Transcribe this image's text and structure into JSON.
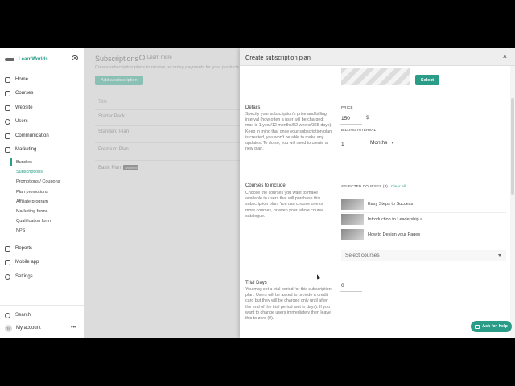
{
  "sidebar": {
    "brand": "LearnWorlds",
    "items": {
      "home": "Home",
      "courses": "Courses",
      "website": "Website",
      "users": "Users",
      "communication": "Communication",
      "marketing": "Marketing",
      "reports": "Reports",
      "mobile_app": "Mobile app",
      "settings": "Settings",
      "search": "Search",
      "account": "My account"
    },
    "marketing_sub": {
      "bundles": "Bundles",
      "subscriptions": "Subscriptions",
      "promotions": "Promotions / Coupons",
      "plan_promotions": "Plan promotions",
      "affiliate": "Affiliate program",
      "forms": "Marketing forms",
      "qualification": "Qualification form",
      "nps": "NPS"
    },
    "avatar_initials": "TS",
    "more": "•••"
  },
  "main": {
    "title": "Subscriptions",
    "learn_more": "Learn more",
    "subtitle": "Create subscription plans to receive recurring payments for your products",
    "add_button": "Add a subscription",
    "table_header": "Title",
    "rows": [
      "Starter Pack",
      "Standard Plan",
      "Premium Plan",
      "Basic Plan"
    ],
    "archived_badge": "archived"
  },
  "panel": {
    "title": "Create subscription plan",
    "close": "×",
    "select_button": "Select",
    "details": {
      "heading": "Details",
      "text": "Specify your subscription's price and billing interval (how often a user will be charged: max is 1 year/12 months/52 weeks/365 days). Keep in mind that once your subscription plan is created, you won't be able to make any updates. To do so, you will need to create a new plan."
    },
    "price": {
      "label": "PRICE",
      "value": "150",
      "unit": "$"
    },
    "billing": {
      "label": "BILLING INTERVAL",
      "value": "1",
      "period": "Months"
    },
    "courses": {
      "heading": "Courses to include",
      "text": "Choose the courses you want to make available to users that will purchase this subscription plan. You can choose one or more courses, or even your whole course catalogue.",
      "selected_label": "SELECTED COURSES (3)",
      "clear_all": "Clear all",
      "list": [
        "Easy Steps to Success",
        "Introduction to Leadership a...",
        "How to Design your Pages"
      ],
      "select_placeholder": "Select courses"
    },
    "trial": {
      "heading": "Trial Days",
      "text": "You may set a trial period for this subscription plan. Users will be asked to provide a credit card but they will be charged only until after the end of the trial period (set in days). If you want to change users immediately then leave this to zero (0).",
      "value": "0"
    }
  },
  "help_button": "Ask for help",
  "colors": {
    "accent": "#2b9c87"
  }
}
